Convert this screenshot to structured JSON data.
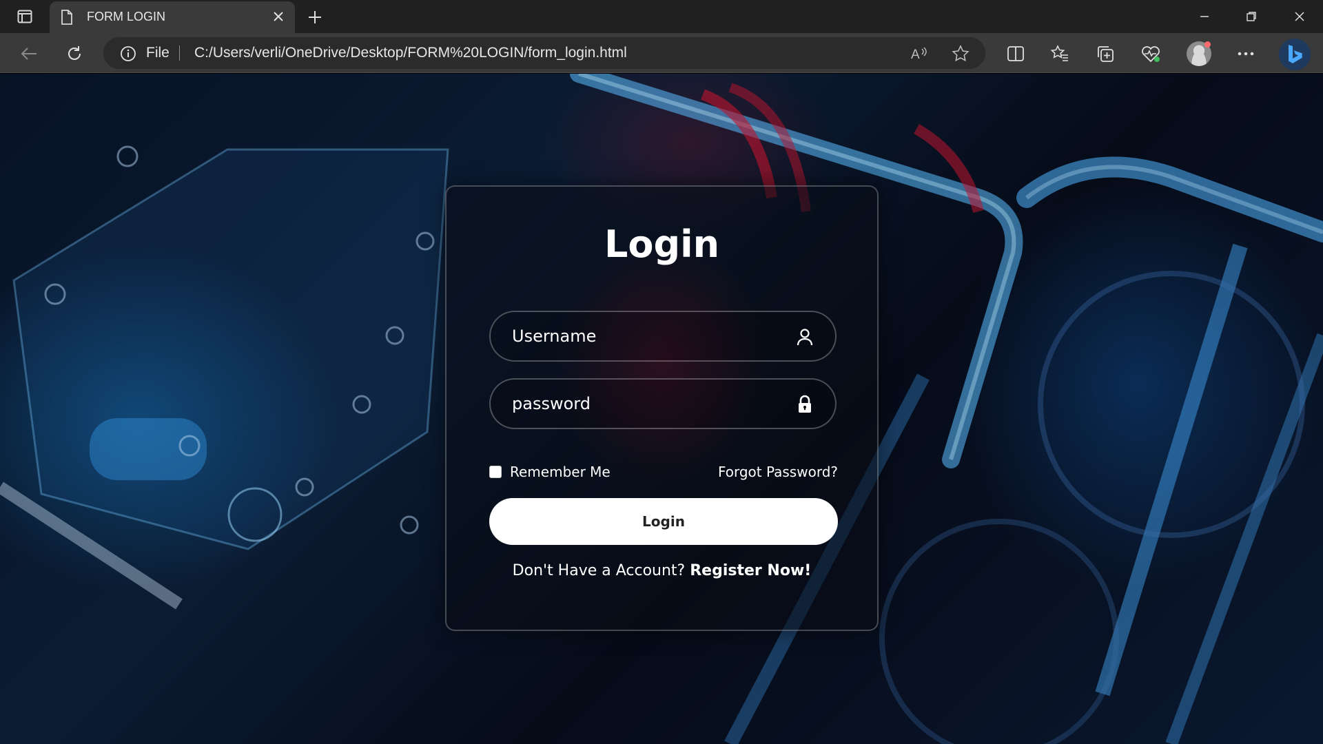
{
  "browser": {
    "tab_title": "FORM LOGIN",
    "scheme_label": "File",
    "url": "C:/Users/verli/OneDrive/Desktop/FORM%20LOGIN/form_login.html",
    "read_aloud_label": "A⁾"
  },
  "login": {
    "title": "Login",
    "username_placeholder": "Username",
    "password_placeholder": "password",
    "remember_label": "Remember Me",
    "remember_checked": false,
    "forgot_label": "Forgot Password?",
    "button_label": "Login",
    "register_prompt": "Don't Have a Account?",
    "register_link": "Register Now!"
  },
  "colors": {
    "chrome_dark": "#202020",
    "chrome_mid": "#3a3a3a",
    "card_border": "rgba(255,255,255,0.25)",
    "button_bg": "#ffffff",
    "accent_red": "#96142d",
    "accent_blue": "#1478be"
  },
  "icons": {
    "username": "user-icon",
    "password": "lock-icon"
  }
}
